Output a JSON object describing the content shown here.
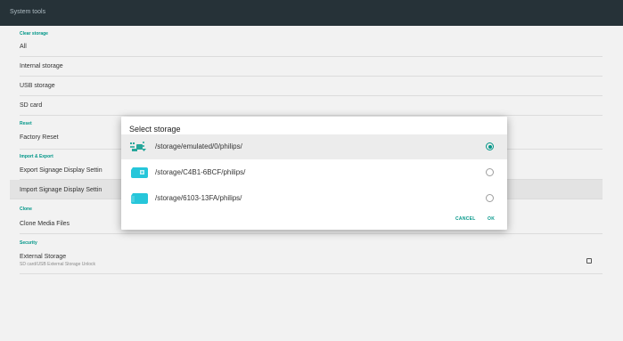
{
  "header": {
    "title": "System tools"
  },
  "sections": {
    "clear_storage": "Clear storage",
    "reset": "Reset",
    "import_export": "Import & Export",
    "clone": "Clone",
    "security": "Security"
  },
  "items": {
    "all": "All",
    "internal_storage": "Internal storage",
    "usb_storage": "USB storage",
    "sd_card": "SD card",
    "factory_reset": "Factory Reset",
    "export_settings": "Export Signage Display Settin",
    "import_settings": "Import Signage Display Settin",
    "clone_media": "Clone Media Files",
    "external_storage": "External Storage",
    "external_storage_sub": "SD card/USB External Storage Unlock"
  },
  "dialog": {
    "title": "Select storage",
    "options": [
      {
        "path": "/storage/emulated/0/philips/",
        "icon": "internal-storage-icon",
        "selected": true
      },
      {
        "path": "/storage/C4B1-6BCF/philips/",
        "icon": "sd-card-icon",
        "selected": false
      },
      {
        "path": "/storage/6103-13FA/philips/",
        "icon": "sd-card-icon",
        "selected": false
      }
    ],
    "cancel": "CANCEL",
    "ok": "OK"
  },
  "colors": {
    "accent": "#009688",
    "header": "#263238",
    "background": "#f2f2f2"
  }
}
